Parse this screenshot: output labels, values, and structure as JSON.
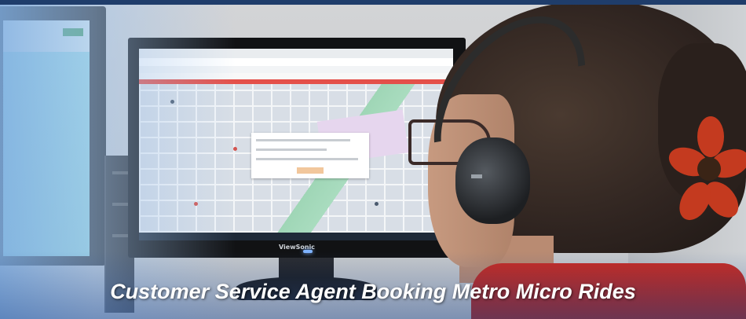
{
  "caption": "Customer Service Agent Booking Metro Micro Rides",
  "monitor_brand": "ViewSonic",
  "colors": {
    "frame_blue": "#1f3d6b",
    "map_red_banner": "#e4504a",
    "shirt_red": "#c72a22",
    "flower_red": "#c43a1f"
  }
}
